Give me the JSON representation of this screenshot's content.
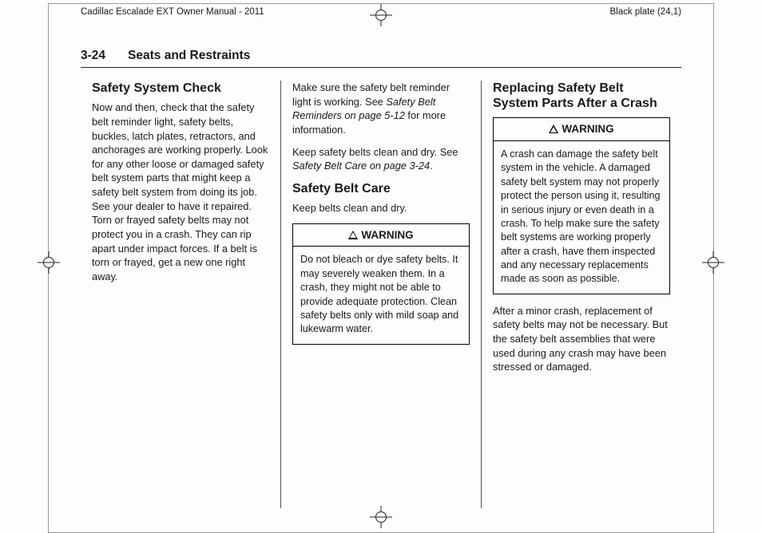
{
  "header": {
    "left": "Cadillac Escalade EXT Owner Manual - 2011",
    "right": "Black plate (24,1)"
  },
  "runningHead": {
    "page": "3-24",
    "section": "Seats and Restraints"
  },
  "col1": {
    "h1": "Safety System Check",
    "p1": "Now and then, check that the safety belt reminder light, safety belts, buckles, latch plates, retractors, and anchorages are working properly. Look for any other loose or damaged safety belt system parts that might keep a safety belt system from doing its job. See your dealer to have it repaired. Torn or frayed safety belts may not protect you in a crash. They can rip apart under impact forces. If a belt is torn or frayed, get a new one right away."
  },
  "col2": {
    "p1a": "Make sure the safety belt reminder light is working. See ",
    "p1i": "Safety Belt Reminders on page 5‑12",
    "p1b": " for more information.",
    "p2a": "Keep safety belts clean and dry. See ",
    "p2i": "Safety Belt Care on page 3‑24",
    "p2b": ".",
    "h2": "Safety Belt Care",
    "p3": "Keep belts clean and dry.",
    "warnLabel": "WARNING",
    "warnBody": "Do not bleach or dye safety belts. It may severely weaken them. In a crash, they might not be able to provide adequate protection. Clean safety belts only with mild soap and lukewarm water."
  },
  "col3": {
    "h1": "Replacing Safety Belt System Parts After a Crash",
    "warnLabel": "WARNING",
    "warnBody": "A crash can damage the safety belt system in the vehicle. A damaged safety belt system may not properly protect the person using it, resulting in serious injury or even death in a crash. To help make sure the safety belt systems are working properly after a crash, have them inspected and any necessary replacements made as soon as possible.",
    "p1": "After a minor crash, replacement of safety belts may not be necessary. But the safety belt assemblies that were used during any crash may have been stressed or damaged."
  }
}
